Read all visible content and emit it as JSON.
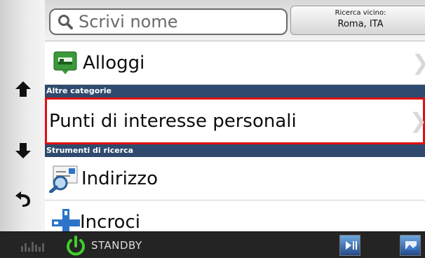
{
  "search": {
    "placeholder": "Scrivi nome"
  },
  "near": {
    "caption": "Ricerca vicino:",
    "location": "Roma, ITA"
  },
  "list": {
    "item_alloggi": "Alloggi",
    "section_other": "Altre categorie",
    "item_poi": "Punti di interesse personali",
    "section_tools": "Strumenti di ricerca",
    "item_address": "Indirizzo",
    "item_crossings": "Incroci"
  },
  "status": {
    "standby_label": "STANDBY"
  },
  "colors": {
    "section_bg": "#2f4a6e",
    "selection_border": "#e01010",
    "power_green": "#3fcf2a",
    "status_bg": "#242424"
  },
  "icons": [
    "arrow-up-icon",
    "arrow-down-icon",
    "back-icon",
    "search-icon",
    "hotel-icon",
    "address-icon",
    "crossroads-icon",
    "equalizer-icon",
    "power-icon",
    "media-play-pause-icon",
    "media-photo-icon",
    "chevron-right-icon"
  ]
}
